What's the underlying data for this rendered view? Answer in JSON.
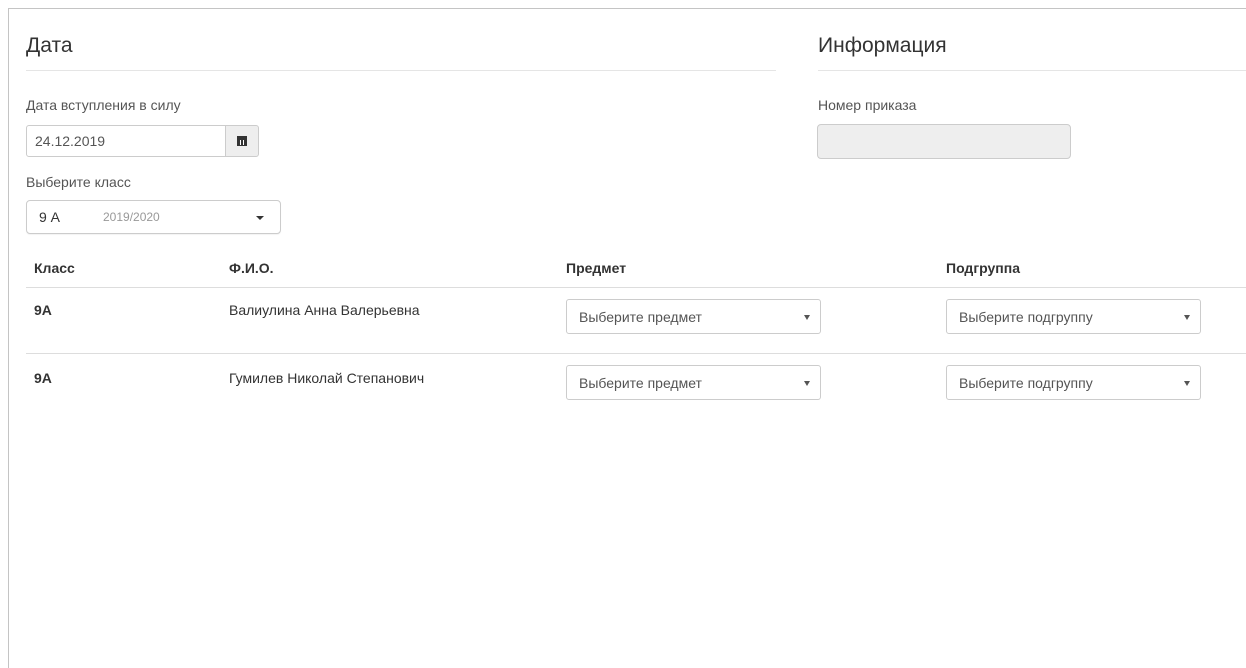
{
  "date_section": {
    "title": "Дата",
    "effective_date_label": "Дата вступления в силу",
    "effective_date_value": "24.12.2019",
    "class_label": "Выберите класс",
    "class_select": {
      "class": "9 А",
      "year": "2019/2020"
    }
  },
  "info_section": {
    "title": "Информация",
    "order_number_label": "Номер приказа",
    "order_number_value": ""
  },
  "table": {
    "headers": {
      "class": "Класс",
      "name": "Ф.И.О.",
      "subject": "Предмет",
      "subgroup": "Подгруппа"
    },
    "rows": [
      {
        "class": "9А",
        "name": "Валиулина Анна Валерьевна",
        "subject": "Выберите предмет",
        "subgroup": "Выберите подгруппу"
      },
      {
        "class": "9А",
        "name": "Гумилев Николай Степанович",
        "subject": "Выберите предмет",
        "subgroup": "Выберите подгруппу"
      }
    ]
  },
  "icons": {
    "calendar": "calendar-icon",
    "dropdown": "caret-down-icon"
  }
}
